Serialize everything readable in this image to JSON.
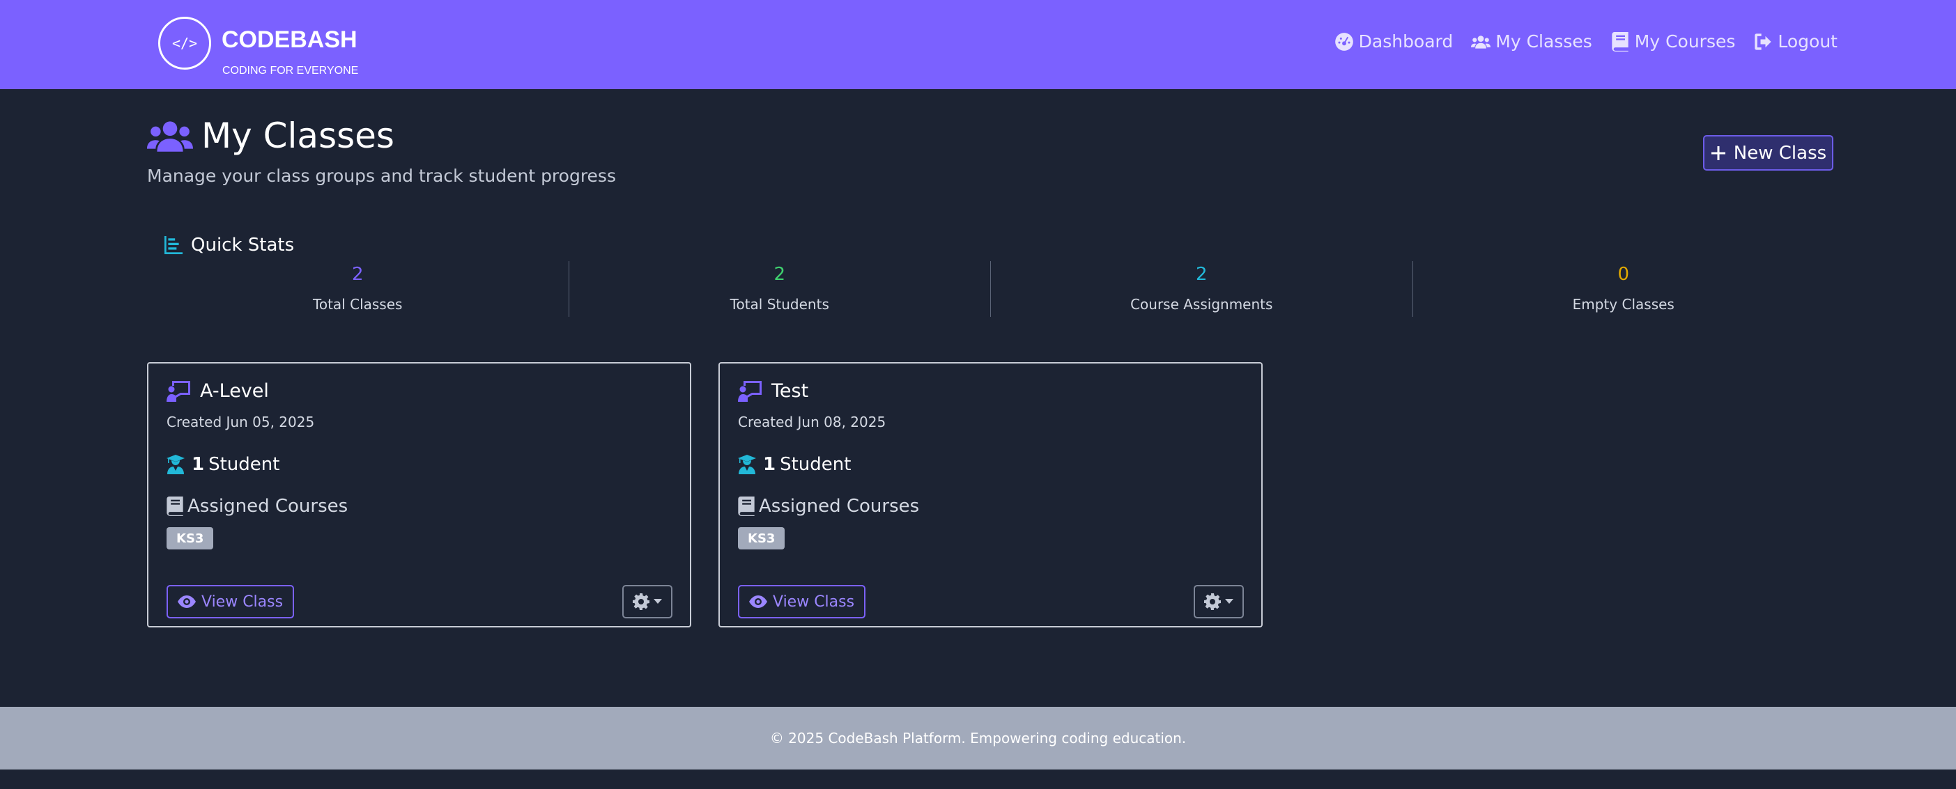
{
  "brand": {
    "logo_text": "</>",
    "name": "CODEBASH",
    "tagline": "CODING FOR EVERYONE"
  },
  "nav": {
    "items": [
      {
        "label": "Dashboard",
        "icon": "dashboard-icon"
      },
      {
        "label": "My Classes",
        "icon": "users-icon"
      },
      {
        "label": "My Courses",
        "icon": "book-icon"
      },
      {
        "label": "Logout",
        "icon": "logout-icon"
      }
    ]
  },
  "page": {
    "title": "My Classes",
    "subtitle": "Manage your class groups and track student progress",
    "new_class_label": "New Class"
  },
  "stats": {
    "title": "Quick Stats",
    "items": [
      {
        "value": "2",
        "label": "Total Classes",
        "color": "#7b61ff"
      },
      {
        "value": "2",
        "label": "Total Students",
        "color": "#3fd16f"
      },
      {
        "value": "2",
        "label": "Course Assignments",
        "color": "#22b8d8"
      },
      {
        "value": "0",
        "label": "Empty Classes",
        "color": "#e0a800"
      }
    ]
  },
  "classes": [
    {
      "name": "A-Level",
      "created": "Created Jun 05, 2025",
      "student_count": "1",
      "student_word": "Student",
      "courses_heading": "Assigned Courses",
      "courses": [
        "KS3"
      ],
      "view_label": "View Class"
    },
    {
      "name": "Test",
      "created": "Created Jun 08, 2025",
      "student_count": "1",
      "student_word": "Student",
      "courses_heading": "Assigned Courses",
      "courses": [
        "KS3"
      ],
      "view_label": "View Class"
    }
  ],
  "footer": {
    "text": "© 2025 CodeBash Platform. Empowering coding education."
  }
}
